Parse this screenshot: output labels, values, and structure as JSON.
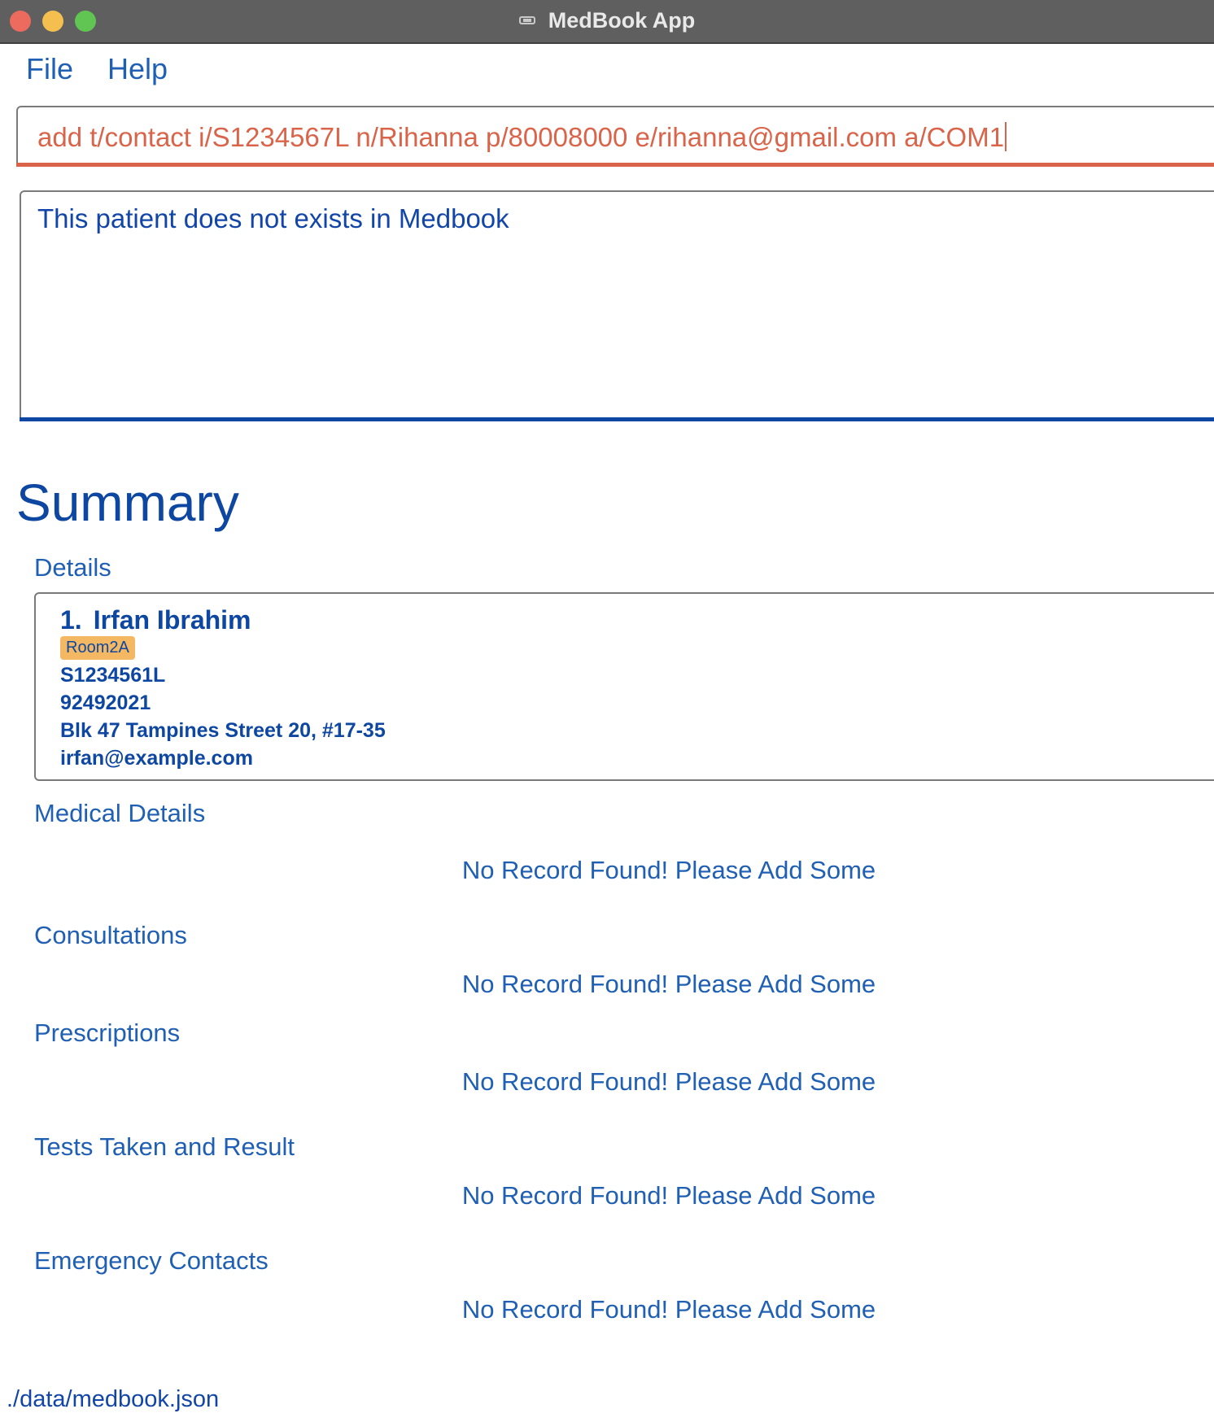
{
  "window": {
    "title": "MedBook App"
  },
  "menu": {
    "file": "File",
    "help": "Help"
  },
  "command": {
    "value": "add t/contact i/S1234567L n/Rihanna p/80008000 e/rihanna@gmail.com a/COM1"
  },
  "result": {
    "message": "This patient does not exists in Medbook"
  },
  "summary": {
    "title": "Summary",
    "details_heading": "Details",
    "patient": {
      "index": "1.",
      "name": "Irfan Ibrahim",
      "tag": "Room2A",
      "nric": "S1234561L",
      "phone": "92492021",
      "address": "Blk 47 Tampines Street 20, #17-35",
      "email": "irfan@example.com"
    },
    "sections": [
      {
        "heading": "Medical Details",
        "empty": "No Record Found! Please Add Some"
      },
      {
        "heading": "Consultations",
        "empty": "No Record Found! Please Add Some"
      },
      {
        "heading": "Prescriptions",
        "empty": "No Record Found! Please Add Some"
      },
      {
        "heading": "Tests Taken and Result",
        "empty": "No Record Found! Please Add Some"
      },
      {
        "heading": "Emergency Contacts",
        "empty": "No Record Found! Please Add Some"
      }
    ]
  },
  "status_bar": {
    "file_path": "./data/medbook.json"
  },
  "colors": {
    "primary_text": "#0d47a1",
    "command_accent": "#d9644a",
    "tag_background": "#f5b862",
    "title_bar": "#5f5f5f"
  },
  "icons": {
    "app": "medbook-app-icon"
  }
}
